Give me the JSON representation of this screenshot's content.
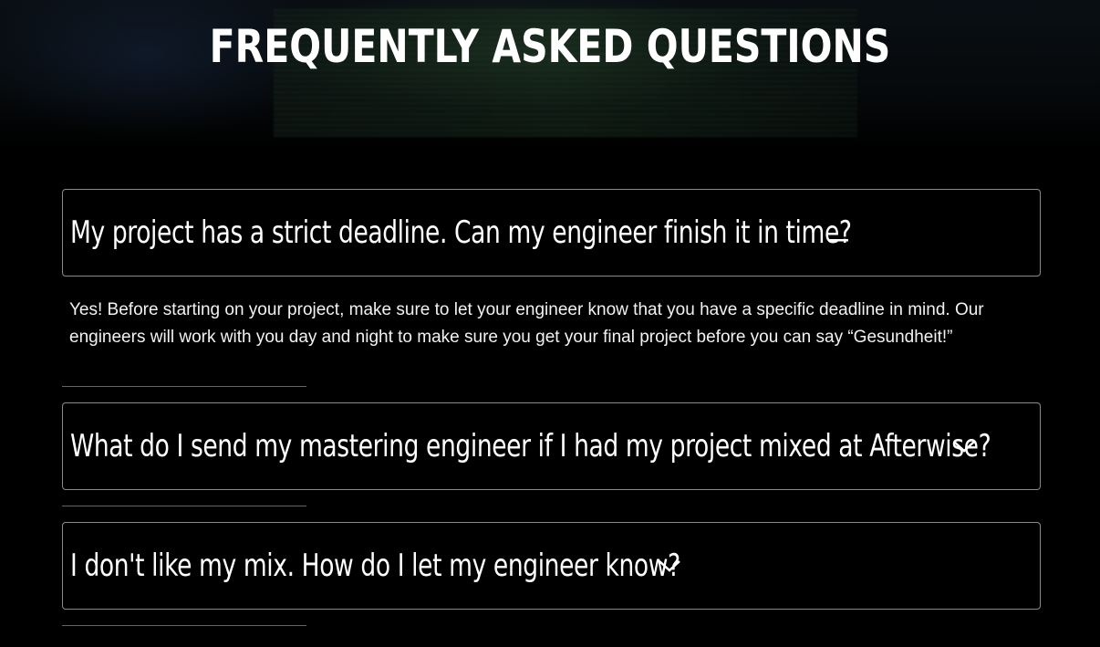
{
  "header": {
    "title": "FREQUENTLY ASKED QUESTIONS"
  },
  "faq": {
    "items": [
      {
        "question": "My project has a strict deadline. Can my engineer finish it in time?",
        "expanded": true,
        "icon": "minus-icon",
        "answer": "Yes! Before starting on your project, make sure to let your engineer know that you have a specific deadline in mind. Our engineers will work with you day and night to make sure you get your final project before you can say “Gesundheit!”"
      },
      {
        "question": "What do I send my mastering engineer if I had my project mixed at Afterwise?",
        "expanded": false,
        "icon": "chevron-down-icon"
      },
      {
        "question": "I don't like my mix. How do I let my engineer know?",
        "expanded": false,
        "icon": "chevron-down-icon"
      }
    ]
  },
  "colors": {
    "background": "#000000",
    "text": "#ffffff",
    "border": "#8a8a8a",
    "divider": "#666666"
  }
}
